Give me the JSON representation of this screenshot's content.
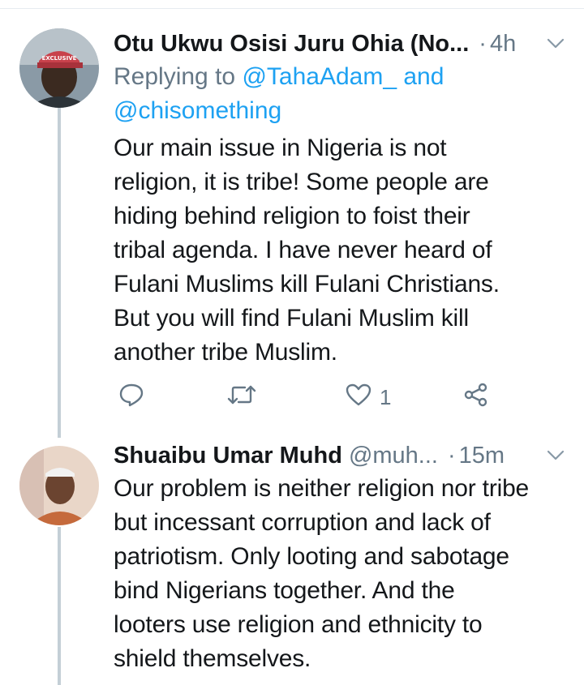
{
  "tweets": [
    {
      "display_name": "Otu Ukwu Osisi Juru Ohia (No...",
      "handle": "",
      "separator": "·",
      "time": "4h",
      "reply_prefix": "Replying to",
      "reply_mention_1": "@TahaAdam_",
      "reply_and": "and",
      "reply_mention_2": "@chisomething",
      "avatar_cap_text": "EXCLUSIVE",
      "body_lines": [
        "Our main issue in Nigeria is not",
        "religion, it is tribe! Some people are",
        "hiding behind religion to foist their",
        "tribal agenda. I have never heard of",
        "Fulani Muslims kill Fulani Christians.",
        "But you will find Fulani Muslim kill",
        "another tribe Muslim."
      ],
      "like_count": "1",
      "icons": [
        "reply-icon",
        "retweet-icon",
        "heart-icon",
        "share-icon"
      ]
    },
    {
      "display_name": "Shuaibu Umar Muhd",
      "handle": "@muh...",
      "separator": "·",
      "time": "15m",
      "body_lines": [
        "Our problem is neither religion nor tribe",
        "but incessant corruption and lack of",
        "patriotism. Only looting and sabotage",
        "bind Nigerians together. And the",
        "looters use religion and ethnicity to",
        "shield themselves."
      ]
    }
  ],
  "colors": {
    "text": "#14171a",
    "secondary": "#657786",
    "link": "#1da1f2",
    "thread_line": "#c4cfd6"
  }
}
